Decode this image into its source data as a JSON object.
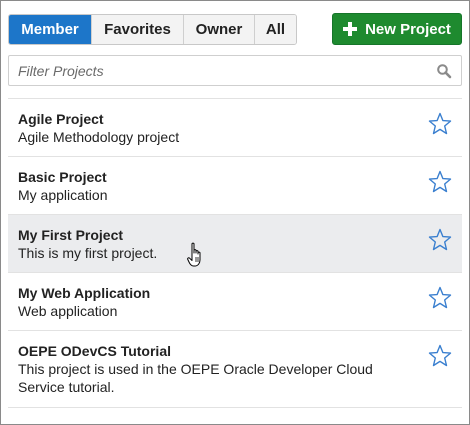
{
  "tabs": [
    {
      "label": "Member",
      "active": true
    },
    {
      "label": "Favorites",
      "active": false
    },
    {
      "label": "Owner",
      "active": false
    },
    {
      "label": "All",
      "active": false
    }
  ],
  "new_project_button": {
    "label": "New Project",
    "icon": "plus-icon",
    "color": "#1e8a2f"
  },
  "filter": {
    "placeholder": "Filter Projects",
    "value": "",
    "icon": "search-icon"
  },
  "projects": [
    {
      "name": "Agile Project",
      "description": "Agile Methodology project",
      "favorite": false
    },
    {
      "name": "Basic Project",
      "description": "My application",
      "favorite": false
    },
    {
      "name": "My First Project",
      "description": "This is my first project.",
      "favorite": false,
      "hovered": true
    },
    {
      "name": "My Web Application",
      "description": "Web application",
      "favorite": false
    },
    {
      "name": "OEPE ODevCS Tutorial",
      "description": "This project is used in the OEPE Oracle Developer Cloud Service tutorial.",
      "favorite": false
    }
  ],
  "colors": {
    "accent": "#1d76c9",
    "star_outline": "#3a7fcf",
    "hover_row": "#ebecee"
  }
}
